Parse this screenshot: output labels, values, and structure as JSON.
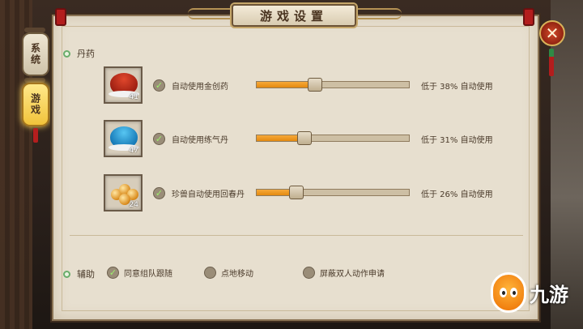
{
  "title": "游戏设置",
  "side_tabs": [
    {
      "label": "系统",
      "active": false
    },
    {
      "label": "游戏",
      "active": true
    }
  ],
  "close_symbol": "✕",
  "sections": {
    "potion": {
      "label": "丹药"
    },
    "assist": {
      "label": "辅助"
    }
  },
  "potions": [
    {
      "icon": "red-powder-icon",
      "count": "41",
      "checked": true,
      "label": "自动使用金创药",
      "percent": 38,
      "threshold": "低于 38% 自动使用"
    },
    {
      "icon": "blue-powder-icon",
      "count": "47",
      "checked": true,
      "label": "自动使用练气丹",
      "percent": 31,
      "threshold": "低于 31% 自动使用"
    },
    {
      "icon": "golden-pills-icon",
      "count": "24",
      "checked": true,
      "label": "珍兽自动使用回春丹",
      "percent": 26,
      "threshold": "低于 26% 自动使用"
    }
  ],
  "assist_options": [
    {
      "label": "同意组队跟随",
      "checked": true
    },
    {
      "label": "点地移动",
      "checked": false
    },
    {
      "label": "屏蔽双人动作申请",
      "checked": false
    }
  ],
  "watermark": {
    "text": "九游"
  },
  "colors": {
    "slider_fill": "#e48a10",
    "check_mark": "#9cf06a",
    "section_dot": "#69ad6b"
  }
}
